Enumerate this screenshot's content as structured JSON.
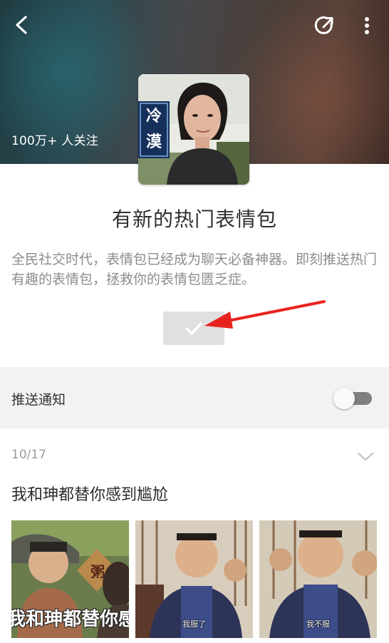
{
  "header": {
    "followers": "100万+ 人关注",
    "back_icon": "back-chevron-icon",
    "share_icon": "share-icon",
    "more_icon": "more-vertical-icon"
  },
  "avatar": {
    "stamp_text": "冷漠"
  },
  "channel": {
    "title": "有新的热门表情包",
    "description": "全民社交时代，表情包已经成为聊天必备神器。即刻推送热门有趣的表情包，拯救你的表情包匮乏症。",
    "subscribe_icon": "checkmark-icon"
  },
  "settings": {
    "push_label": "推送通知",
    "push_enabled": false
  },
  "post": {
    "date": "10/17",
    "title": "我和珅都替你感到尴尬",
    "images": [
      {
        "caption": "我和珅都替你感到尴尬",
        "stamp": "粥",
        "style": "big"
      },
      {
        "caption": "我服了",
        "style": "small"
      },
      {
        "caption": "我不服",
        "style": "small"
      }
    ]
  },
  "colors": {
    "arrow": "#e8231f",
    "toggle_track": "#7f7f7f",
    "section_bg": "#f2f2f2"
  }
}
